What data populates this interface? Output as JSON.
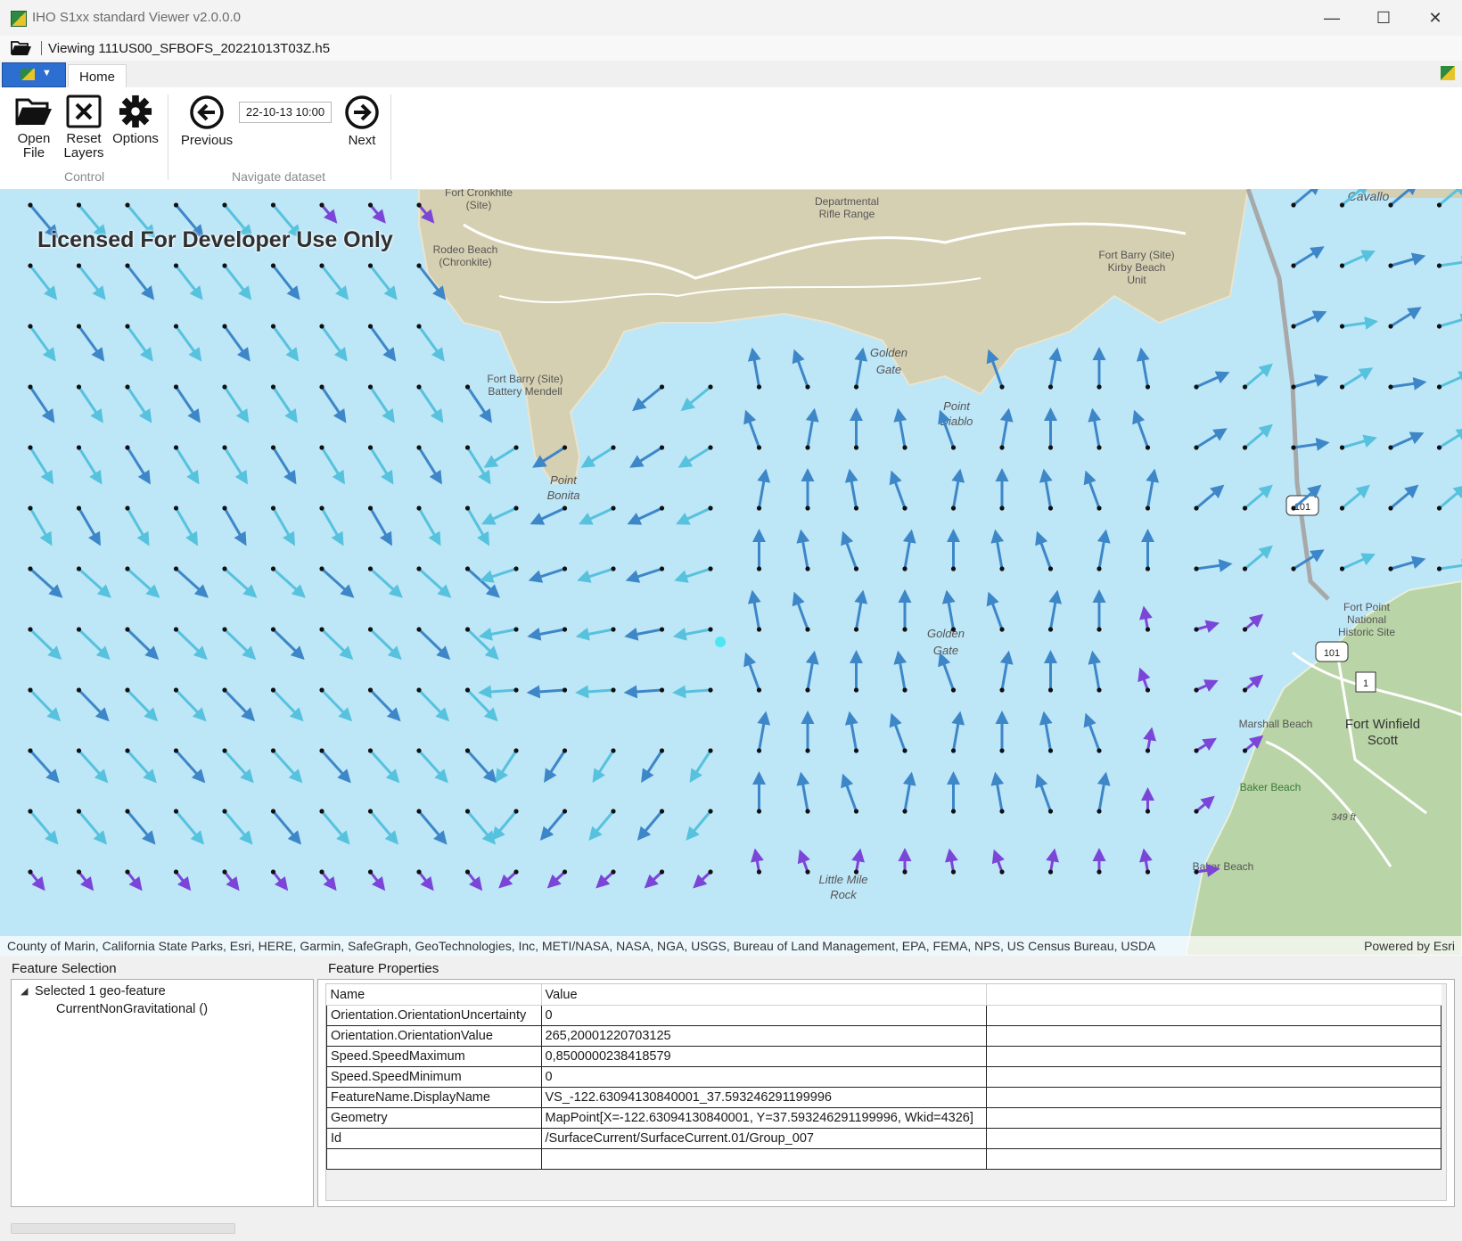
{
  "window": {
    "title": "IHO S1xx standard Viewer v2.0.0.0",
    "controls": {
      "minimize": "—",
      "maximize": "☐",
      "close": "✕"
    }
  },
  "path": {
    "text": "Viewing 111US00_SFBOFS_20221013T03Z.h5"
  },
  "ribbon": {
    "tab_home": "Home",
    "open_label": "Open\nFile",
    "reset_label": "Reset\nLayers",
    "options_label": "Options",
    "control_group": "Control",
    "previous_label": "Previous",
    "date_value": "22-10-13 10:00",
    "next_label": "Next",
    "navigate_group": "Navigate dataset"
  },
  "map": {
    "license_text": "Licensed For Developer Use Only",
    "attribution": "County of Marin, California State Parks, Esri, HERE, Garmin, SafeGraph, GeoTechnologies, Inc, METI/NASA, NASA, NGA, USGS, Bureau of Land Management, EPA, FEMA, NPS, US Census Bureau, USDA",
    "powered_by": "Powered by Esri",
    "colors": {
      "water": "#bde6f7",
      "land": "#d9d3b8",
      "land_green": "#b9d4a6",
      "arrow_fast": "#3d86c8",
      "arrow_medium": "#56c2dd",
      "arrow_slow": "#7b45d8"
    },
    "labels": [
      "Fort Cronkhite\n(Site)",
      "Departmental\nRifle Range",
      "Cavallo",
      "Rodeo Beach\n(Chronkite)",
      "Fort Barry (Site)\nKirby Beach\nUnit",
      "Golden\nGate",
      "Fort Barry (Site)\nBattery Mendell",
      "Point\nDiablo",
      "Point\nBonita",
      "101",
      "Fort Point\nNational\nHistoric Site",
      "101",
      "Golden\nGate",
      "1",
      "Marshall Beach",
      "Fort Winfield\nScott",
      "Baker Beach",
      "349 ft",
      "Baker Beach",
      "Little Mile\nRock"
    ]
  },
  "feature_selection": {
    "title": "Feature Selection",
    "root": "Selected 1 geo-feature",
    "child": "CurrentNonGravitational ()"
  },
  "feature_properties": {
    "title": "Feature Properties",
    "columns": [
      "Name",
      "Value"
    ],
    "rows": [
      [
        "Orientation.OrientationUncertainty",
        "0"
      ],
      [
        "Orientation.OrientationValue",
        "265,20001220703125"
      ],
      [
        "Speed.SpeedMaximum",
        "0,8500000238418579"
      ],
      [
        "Speed.SpeedMinimum",
        "0"
      ],
      [
        "FeatureName.DisplayName",
        "VS_-122.63094130840001_37.593246291199996"
      ],
      [
        "Geometry",
        "MapPoint[X=-122.63094130840001, Y=37.593246291199996, Wkid=4326]"
      ],
      [
        "Id",
        "/SurfaceCurrent/SurfaceCurrent.01/Group_007"
      ]
    ]
  }
}
